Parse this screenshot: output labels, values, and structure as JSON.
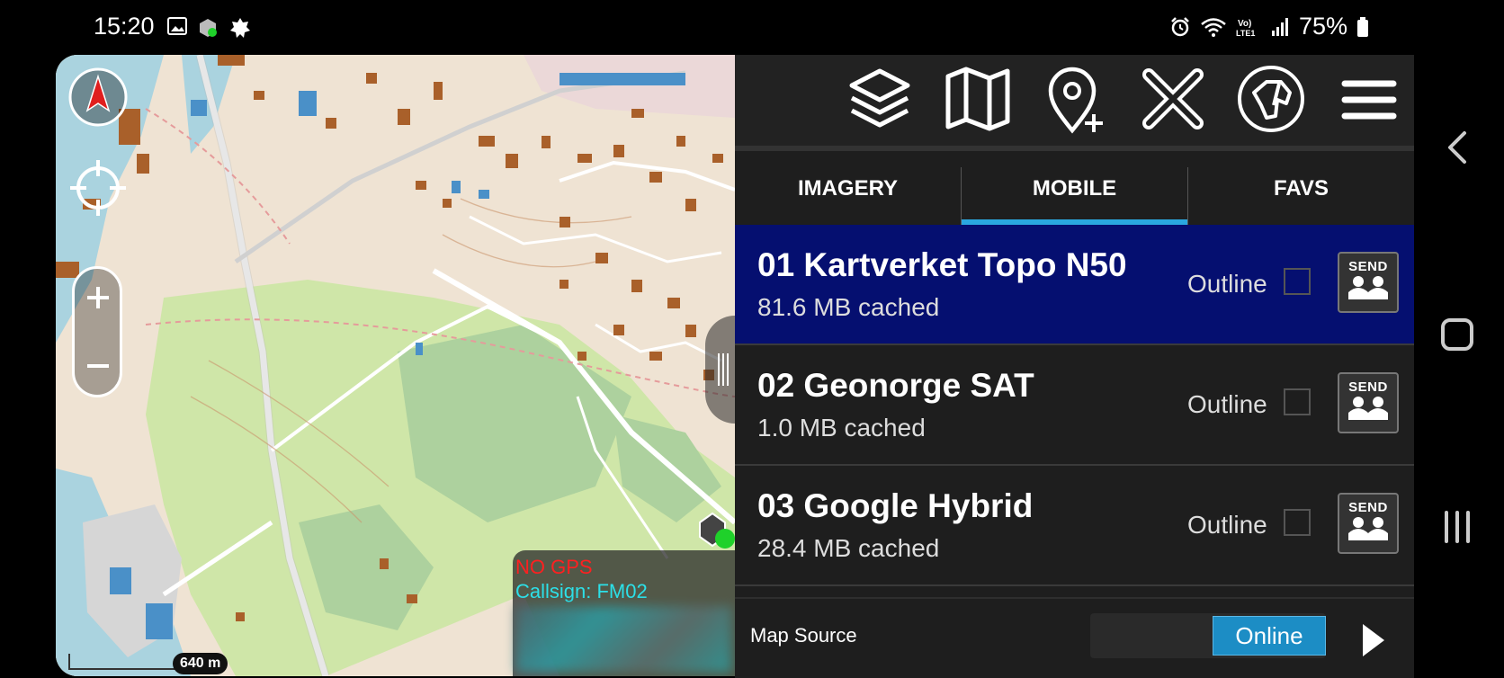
{
  "status_bar": {
    "time": "15:20",
    "battery": "75%",
    "icons": [
      "image-icon",
      "tak-icon",
      "settings-flower-icon",
      "alarm-icon",
      "wifi-icon",
      "volte-icon",
      "signal-icon",
      "battery-icon"
    ]
  },
  "map": {
    "scale_label": "640 m",
    "gps_status": "NO GPS",
    "callsign": "Callsign: FM02",
    "colors": {
      "gps_status": "#ff2020",
      "callsign": "#2ce0e8"
    }
  },
  "toolbar": {
    "icons": [
      "layers-icon",
      "map-icon",
      "add-point-icon",
      "close-icon",
      "dog-icon",
      "menu-icon"
    ]
  },
  "tabs": [
    {
      "label": "IMAGERY",
      "active": false
    },
    {
      "label": "MOBILE",
      "active": true
    },
    {
      "label": "FAVS",
      "active": false
    }
  ],
  "layers": [
    {
      "title": "01 Kartverket Topo N50",
      "cached": "81.6 MB cached",
      "outline_label": "Outline",
      "send_label": "SEND",
      "selected": true
    },
    {
      "title": "02 Geonorge SAT",
      "cached": "1.0 MB cached",
      "outline_label": "Outline",
      "send_label": "SEND",
      "selected": false
    },
    {
      "title": "03 Google Hybrid",
      "cached": "28.4 MB cached",
      "outline_label": "Outline",
      "send_label": "SEND",
      "selected": false
    }
  ],
  "footer": {
    "label": "Map Source",
    "toggle_value": "Online"
  },
  "accent": "#2aa8e0",
  "selected_row_color": "#050f70"
}
